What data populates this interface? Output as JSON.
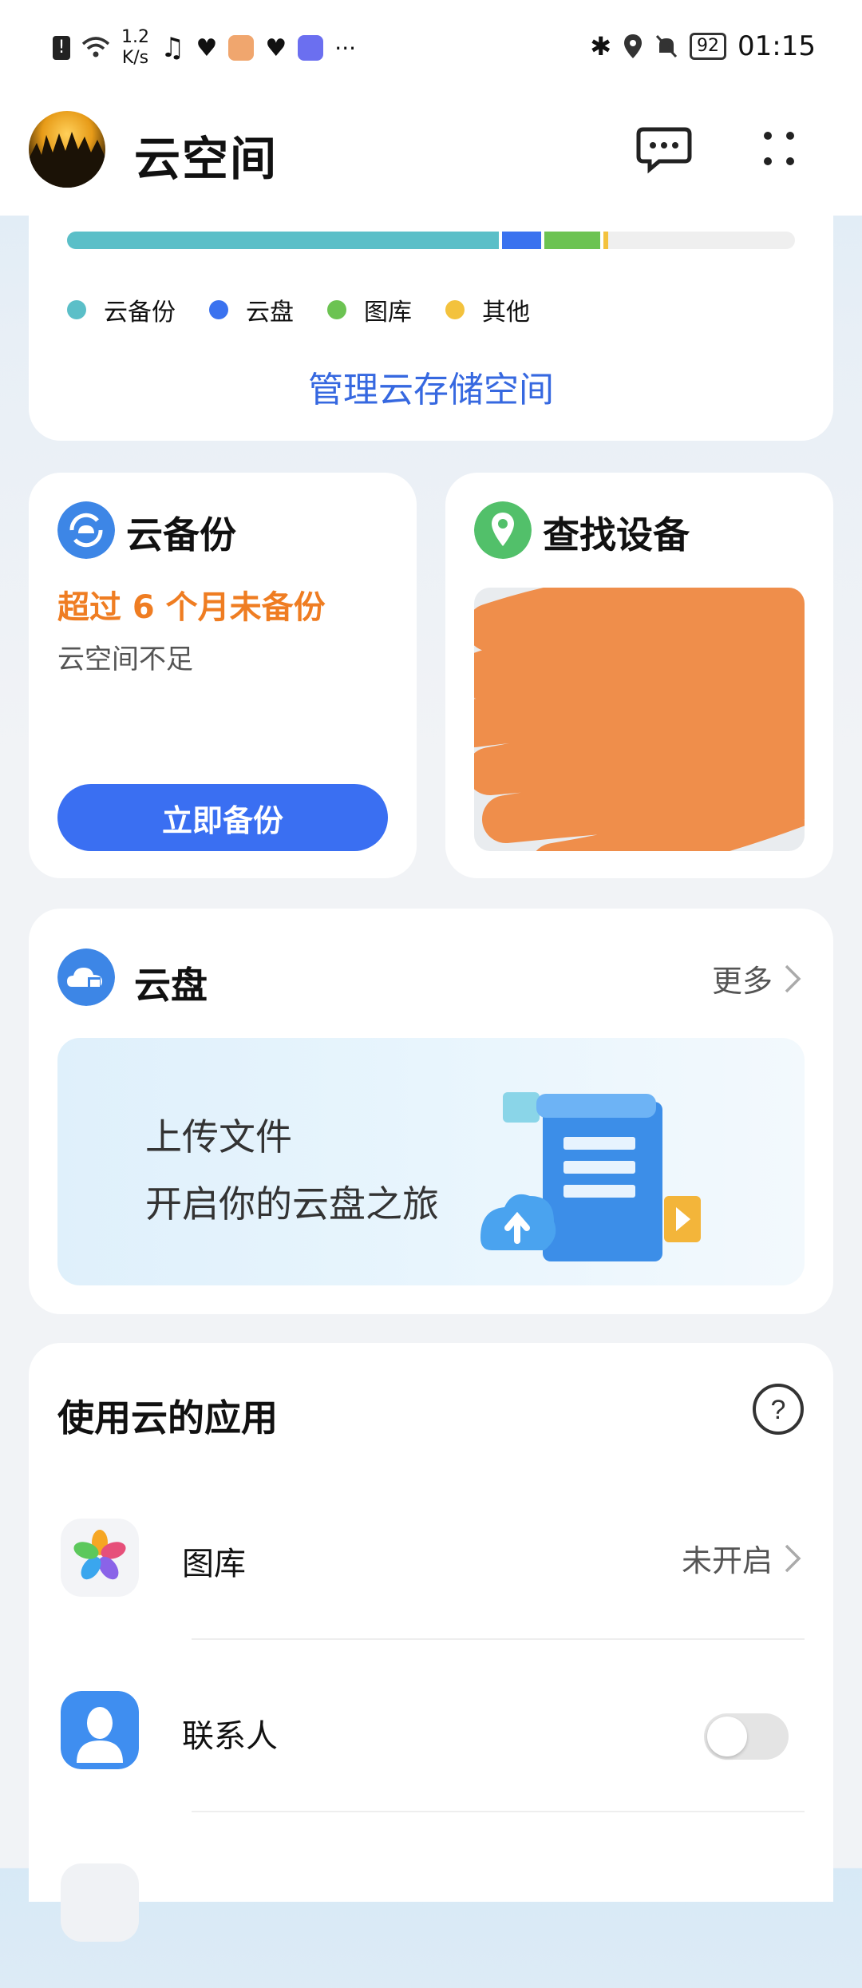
{
  "status_bar": {
    "net_speed_value": "1.2",
    "net_speed_unit": "K/s",
    "ellipsis": "···",
    "battery": "92",
    "time": "01:15"
  },
  "header": {
    "title": "云空间"
  },
  "storage": {
    "legend": [
      "云备份",
      "云盘",
      "图库",
      "其他"
    ],
    "colors": {
      "backup": "#5bbfc8",
      "drive": "#3a72ef",
      "gallery": "#6cc352",
      "other": "#f3c23d"
    },
    "manage_link": "管理云存储空间"
  },
  "backup_card": {
    "title": "云备份",
    "warning": "超过 6 个月未备份",
    "subtitle": "云空间不足",
    "button": "立即备份"
  },
  "find_card": {
    "title": "查找设备"
  },
  "cloud_drive": {
    "title": "云盘",
    "more": "更多",
    "banner_line1": "上传文件",
    "banner_line2": "开启你的云盘之旅"
  },
  "apps": {
    "title": "使用云的应用",
    "items": [
      {
        "name": "图库",
        "status": "未开启"
      },
      {
        "name": "联系人",
        "toggle": "off"
      }
    ]
  }
}
